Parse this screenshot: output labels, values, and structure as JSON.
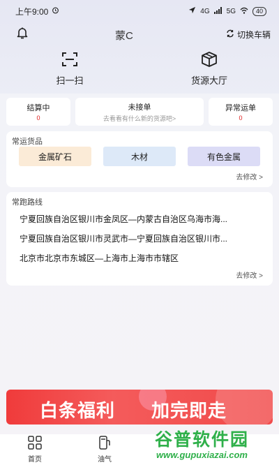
{
  "status": {
    "time": "上午9:00",
    "battery": "40",
    "net1": "4G",
    "net2": "5G"
  },
  "header": {
    "title": "蒙C",
    "switch_label": "切换车辆",
    "icons": {
      "bell": "bell-icon",
      "switch": "refresh-icon"
    }
  },
  "quick_actions": [
    {
      "label": "扫一扫",
      "icon": "scan-icon"
    },
    {
      "label": "货源大厅",
      "icon": "box-icon"
    }
  ],
  "stats": {
    "settling": {
      "label": "结算中",
      "value": "0"
    },
    "pending": {
      "label": "未接单",
      "hint": "去看看有什么新的货源吧>"
    },
    "abnormal": {
      "label": "异常运单",
      "value": "0"
    }
  },
  "goods": {
    "title": "常运货品",
    "items": [
      {
        "label": "金属矿石",
        "color": "#fbebd7"
      },
      {
        "label": "木材",
        "color": "#dde9f8"
      },
      {
        "label": "有色金属",
        "color": "#dcdcf6"
      }
    ],
    "edit": "去修改 >"
  },
  "routes": {
    "title": "常跑路线",
    "items": [
      "宁夏回族自治区银川市金凤区—内蒙古自治区乌海市海...",
      "宁夏回族自治区银川市灵武市—宁夏回族自治区银川市...",
      "北京市北京市东城区—上海市上海市市辖区"
    ],
    "edit": "去修改 >"
  },
  "banner": {
    "text1": "白条福利",
    "text2": "加完即走",
    "color": "#f03b3b"
  },
  "tabs": [
    {
      "label": "首页",
      "icon": "grid-icon"
    },
    {
      "label": "油气",
      "icon": "fuel-icon"
    }
  ],
  "watermark": {
    "main": "谷普软件园",
    "sub": "www.gupuxiazai.com"
  }
}
